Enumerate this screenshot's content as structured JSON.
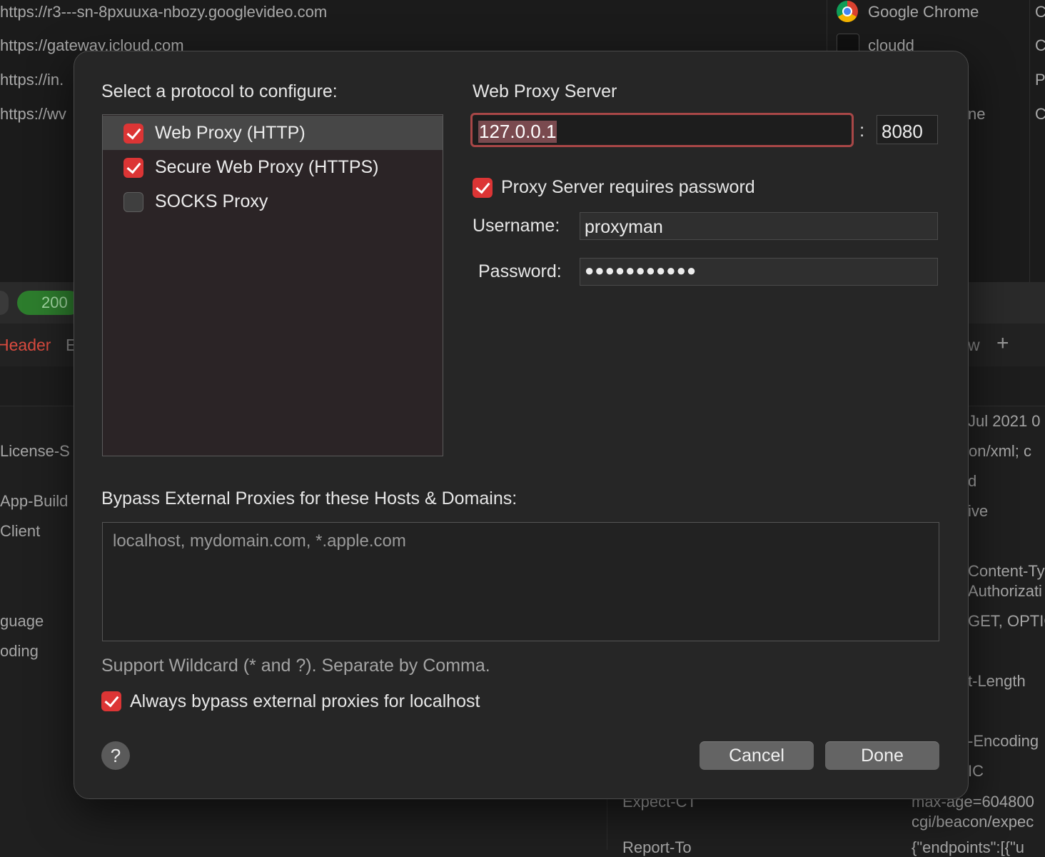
{
  "background": {
    "urls": [
      "https://r3---sn-8pxuuxa-nbozy.googlevideo.com",
      "https://gateway.icloud.com",
      "https://in.",
      "https://wv"
    ],
    "apps": [
      "Google Chrome",
      "cloudd",
      "",
      "ne"
    ],
    "col3": [
      "C",
      "C",
      "P",
      "C"
    ],
    "status_pill": "200",
    "tab_header": "Header",
    "tab_e": "E",
    "tab_w": "w",
    "tab_plus": "+",
    "left_keys": [
      "License-S",
      "App-Build",
      "Client",
      "guage",
      "oding"
    ],
    "right_vals": [
      "Jul 2021 0",
      "tion/xml; c",
      "d",
      "ive",
      "Content-Ty",
      "Authorizati",
      "GET, OPTIC",
      "t-Length",
      "-Encoding",
      "IC",
      "max-age=604800",
      "cgi/beacon/expec",
      "{\"endpoints\":[{\"u"
    ],
    "mid_keys": [
      "Expect-CT",
      "Report-To"
    ]
  },
  "dialog": {
    "protocol_prompt": "Select a protocol to configure:",
    "protocols": [
      {
        "label": "Web Proxy (HTTP)",
        "checked": true,
        "selected": true
      },
      {
        "label": "Secure Web Proxy (HTTPS)",
        "checked": true,
        "selected": false
      },
      {
        "label": "SOCKS Proxy",
        "checked": false,
        "selected": false
      }
    ],
    "server_title": "Web Proxy Server",
    "host": "127.0.0.1",
    "port_separator": ":",
    "port": "8080",
    "requires_password_label": "Proxy Server requires password",
    "requires_password": true,
    "username_label": "Username:",
    "username": "proxyman",
    "password_label": "Password:",
    "password_mask": "●●●●●●●●●●●",
    "bypass_title": "Bypass External Proxies for these Hosts & Domains:",
    "bypass_placeholder": "localhost, mydomain.com, *.apple.com",
    "bypass_hint": "Support Wildcard (* and ?). Separate by Comma.",
    "always_bypass_label": "Always bypass external proxies for localhost",
    "always_bypass": true,
    "help_label": "?",
    "cancel_label": "Cancel",
    "done_label": "Done",
    "accent_color": "#dc3535"
  }
}
